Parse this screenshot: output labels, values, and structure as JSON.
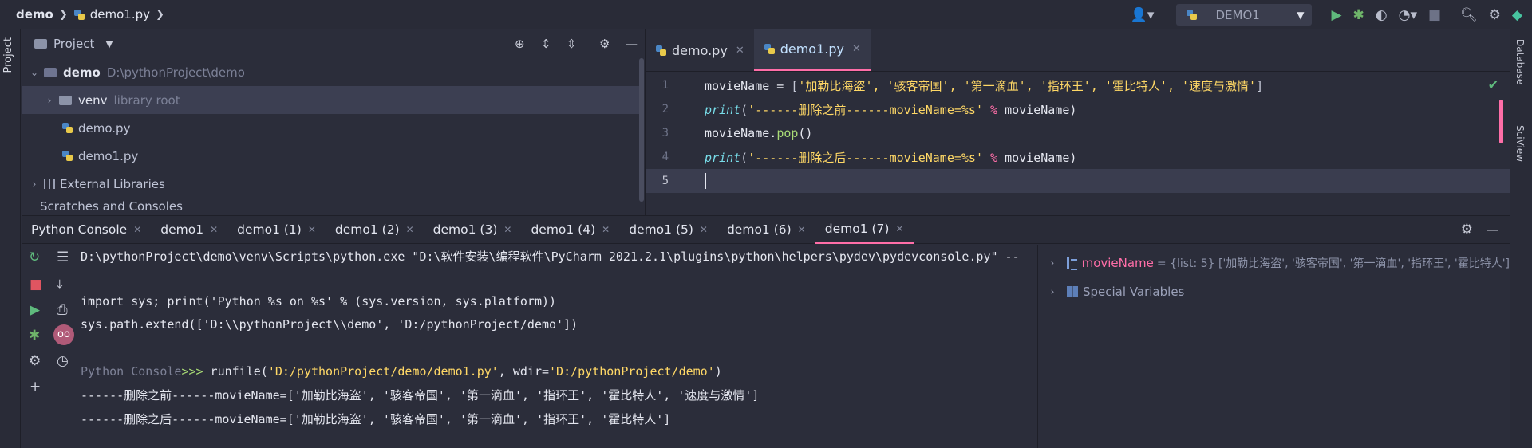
{
  "navbar": {
    "project_name": "demo",
    "file_name": "demo1.py",
    "run_config": "DEMO1"
  },
  "side": {
    "left_tab": "Project",
    "right_tabs": [
      "Database",
      "SciView"
    ]
  },
  "project_panel": {
    "title": "Project",
    "tree": [
      {
        "name": "demo",
        "detail": "D:\\pythonProject\\demo"
      },
      {
        "name": "venv",
        "detail": "library root"
      },
      {
        "name": "demo.py"
      },
      {
        "name": "demo1.py"
      },
      {
        "name": "External Libraries"
      },
      {
        "name": "Scratches and Consoles"
      }
    ]
  },
  "editor": {
    "tabs": [
      {
        "label": "demo.py"
      },
      {
        "label": "demo1.py"
      }
    ],
    "lines": [
      {
        "num": "1",
        "a": "movieName = ",
        "b": "[",
        "c": "'加勒比海盗', '骇客帝国', '第一滴血', '指环王', '霍比特人', '速度与激情'",
        "d": "]"
      },
      {
        "num": "2",
        "fn": "print",
        "p1": "(",
        "str": "'------删除之前------movieName=%s'",
        "op": " % ",
        "rest": "movieName)"
      },
      {
        "num": "3",
        "obj": "movieName.",
        "meth": "pop",
        "rest": "()"
      },
      {
        "num": "4",
        "fn": "print",
        "p1": "(",
        "str": "'------删除之后------movieName=%s'",
        "op": " % ",
        "rest": "movieName)"
      },
      {
        "num": "5"
      }
    ]
  },
  "tool_tabs": [
    "Python Console",
    "demo1",
    "demo1 (1)",
    "demo1 (2)",
    "demo1 (3)",
    "demo1 (4)",
    "demo1 (5)",
    "demo1 (6)",
    "demo1 (7)"
  ],
  "console": {
    "lines": [
      "D:\\pythonProject\\demo\\venv\\Scripts\\python.exe \"D:\\软件安装\\编程软件\\PyCharm 2021.2.1\\plugins\\python\\helpers\\pydev\\pydevconsole.py\" --mo",
      "import sys; print('Python %s on %s' % (sys.version, sys.platform))",
      "sys.path.extend(['D:\\\\pythonProject\\\\demo', 'D:/pythonProject/demo'])",
      "------删除之前------movieName=['加勒比海盗', '骇客帝国', '第一滴血', '指环王', '霍比特人', '速度与激情']",
      "------删除之后------movieName=['加勒比海盗', '骇客帝国', '第一滴血', '指环王', '霍比特人']"
    ],
    "prompt_label": "Python Console",
    "prompt_chevrons": ">>>",
    "runfile": {
      "pre": " runfile(",
      "s1": "'D:/pythonProject/demo/demo1.py'",
      "mid": ", wdir=",
      "s2": "'D:/pythonProject/demo'",
      "end": ")"
    }
  },
  "variables": [
    {
      "name": "movieName",
      "value": "= {list: 5} ['加勒比海盗', '骇客帝国', '第一滴血', '指环王', '霍比特人']"
    },
    {
      "name": "Special Variables"
    }
  ]
}
